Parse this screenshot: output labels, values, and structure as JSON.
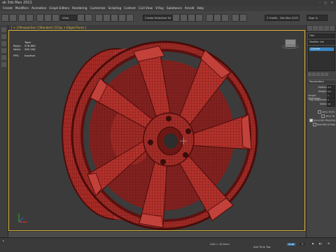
{
  "window": {
    "title": "ak 3ds Max 2022"
  },
  "menu": [
    "Create",
    "Modifiers",
    "Animation",
    "Graph Editors",
    "Rendering",
    "Customize",
    "Scripting",
    "Content",
    "Civil View",
    "V-Ray",
    "Substance",
    "Arnold",
    "Help"
  ],
  "toolbar": {
    "view_dropdown": "View",
    "selection_set": "Create Selection Se",
    "signin": "Sign In",
    "workspace": "3 Grafik - 3ds Max 2022"
  },
  "ribbon_labels": [
    "Object Paint",
    "Populate"
  ],
  "viewport": {
    "label": "[ + ] [Perspective ] [Standard ] [Clay + Edged Faces ]",
    "stats": {
      "total_label": "Total",
      "polys_label": "Polys:",
      "polys_value": "578 690",
      "verts_label": "Verts:",
      "verts_value": "263 294",
      "fps_label": "FPS:",
      "fps_value": "Inactive"
    }
  },
  "command_panel": {
    "object_name": "Obe",
    "modifier_list": "Modifier List",
    "stack_item": "Cylinder",
    "rollout_title": "Parameters",
    "params": [
      {
        "label": "Radius:",
        "value": "0.0"
      },
      {
        "label": "Height:",
        "value": "0.0"
      },
      {
        "label": "Height Segments:",
        "value": "1"
      },
      {
        "label": "Cap Segments:",
        "value": "1"
      },
      {
        "label": "Sides:",
        "value": "18"
      }
    ],
    "checks": [
      {
        "label": "Slice From:",
        "checked": false
      },
      {
        "label": "Slice To:",
        "checked": false
      },
      {
        "label": "Generate Mapping",
        "checked": true
      },
      {
        "label": "Real-World Map",
        "checked": false
      }
    ]
  },
  "status": {
    "grid": "Grid = 10,0mm",
    "add_time_tag": "Add Time Tag",
    "auto": "Auto",
    "frame": "0"
  },
  "colors": {
    "accent": "#e6c042",
    "wheel": "#b0302b",
    "wheel_dark": "#6f1714",
    "selection": "#2f6d9c"
  }
}
